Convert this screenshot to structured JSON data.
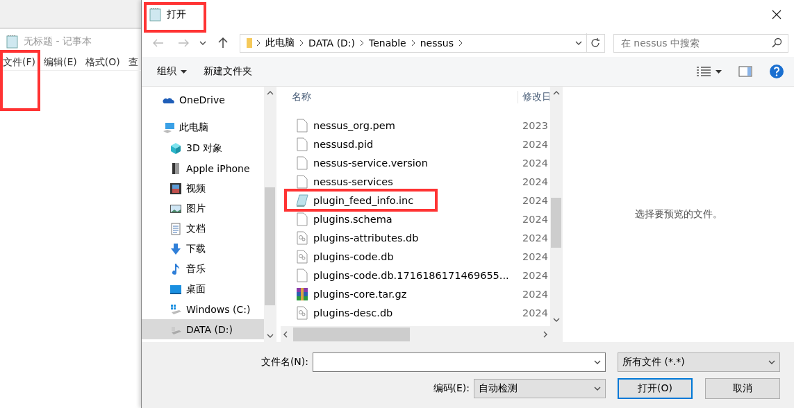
{
  "notepad": {
    "title": "无标题 - 记事本",
    "menu": [
      {
        "label": "文件(F)",
        "highlighted": true
      },
      {
        "label": "编辑(E)",
        "highlighted": false
      },
      {
        "label": "格式(O)",
        "highlighted": false
      },
      {
        "label": "查",
        "highlighted": false
      }
    ]
  },
  "dialog": {
    "title": "打开",
    "title_highlighted": true,
    "breadcrumb": [
      "此电脑",
      "DATA (D:)",
      "Tenable",
      "nessus"
    ],
    "search": {
      "placeholder": "在 nessus 中搜索"
    },
    "toolbar": {
      "organize": "组织",
      "new_folder": "新建文件夹"
    },
    "nav": [
      {
        "label": "OneDrive",
        "kind": "cloud",
        "selected": false
      },
      {
        "label": "此电脑",
        "kind": "pc",
        "selected": false,
        "children": [
          {
            "label": "3D 对象",
            "kind": "cube",
            "selected": false
          },
          {
            "label": "Apple iPhone",
            "kind": "phone",
            "selected": false
          },
          {
            "label": "视频",
            "kind": "video",
            "selected": false
          },
          {
            "label": "图片",
            "kind": "picture",
            "selected": false
          },
          {
            "label": "文档",
            "kind": "document",
            "selected": false
          },
          {
            "label": "下载",
            "kind": "download",
            "selected": false
          },
          {
            "label": "音乐",
            "kind": "music",
            "selected": false
          },
          {
            "label": "桌面",
            "kind": "desktop",
            "selected": false
          },
          {
            "label": "Windows (C:)",
            "kind": "windrive",
            "selected": false
          },
          {
            "label": "DATA (D:)",
            "kind": "drive",
            "selected": true
          }
        ]
      }
    ],
    "columns": [
      "名称",
      "修改日"
    ],
    "files": [
      {
        "name": "nessus_org.pem",
        "kind": "file",
        "date": "2023",
        "highlighted": false
      },
      {
        "name": "nessusd.pid",
        "kind": "file",
        "date": "2024",
        "highlighted": false
      },
      {
        "name": "nessus-service.version",
        "kind": "file",
        "date": "2024",
        "highlighted": false
      },
      {
        "name": "nessus-services",
        "kind": "file",
        "date": "2024",
        "highlighted": false
      },
      {
        "name": "plugin_feed_info.inc",
        "kind": "notepad",
        "date": "2024",
        "highlighted": true
      },
      {
        "name": "plugins.schema",
        "kind": "file",
        "date": "2024",
        "highlighted": false
      },
      {
        "name": "plugins-attributes.db",
        "kind": "database",
        "date": "2024",
        "highlighted": false
      },
      {
        "name": "plugins-code.db",
        "kind": "database",
        "date": "2024",
        "highlighted": false
      },
      {
        "name": "plugins-code.db.1716186171469655...",
        "kind": "file",
        "date": "2024",
        "highlighted": false
      },
      {
        "name": "plugins-core.tar.gz",
        "kind": "archive",
        "date": "2024",
        "highlighted": false
      },
      {
        "name": "plugins-desc.db",
        "kind": "database",
        "date": "2024",
        "highlighted": false
      }
    ],
    "preview": "选择要预览的文件。",
    "filename": {
      "label": "文件名(N):"
    },
    "filetype": "所有文件  (*.*)",
    "encoding": {
      "label": "编码(E):",
      "value": "自动检测"
    },
    "buttons": [
      {
        "label": "打开(O)",
        "default": true
      },
      {
        "label": "取消",
        "default": false
      }
    ]
  }
}
